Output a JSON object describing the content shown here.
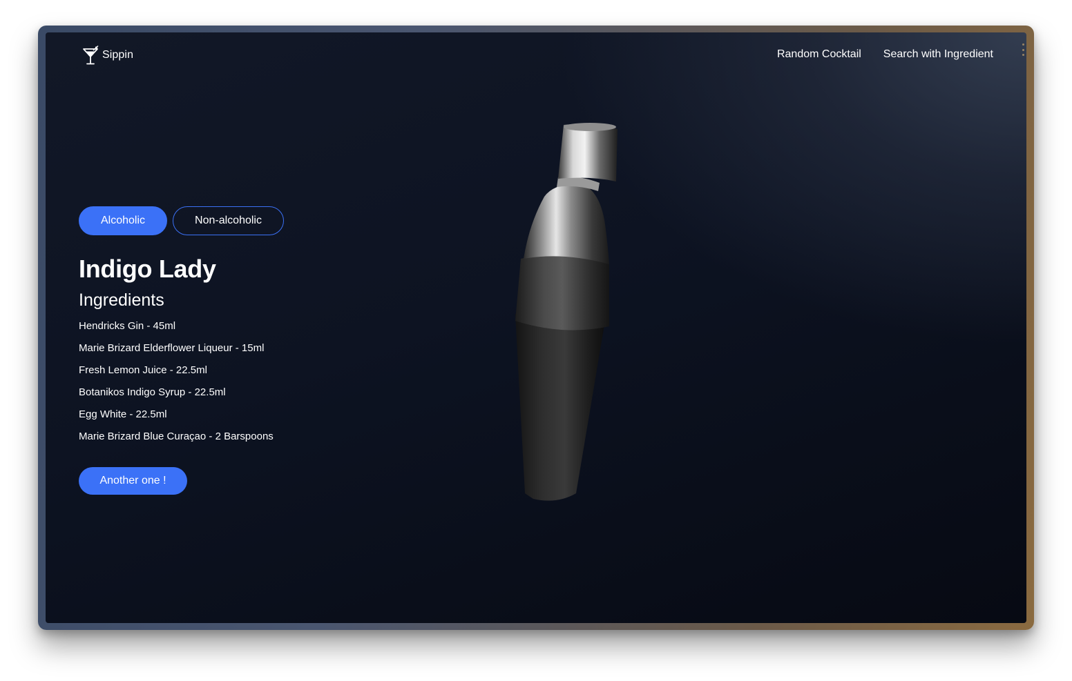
{
  "app": {
    "brand_name": "Sippin",
    "logo_icon": "cocktail-glass-icon"
  },
  "nav": {
    "links": [
      "Random Cocktail",
      "Search with Ingredient"
    ]
  },
  "filters": {
    "options": [
      "Alcoholic",
      "Non-alcoholic"
    ],
    "selected": "Alcoholic"
  },
  "cocktail": {
    "name": "Indigo Lady",
    "ingredients_heading": "Ingredients",
    "ingredients": [
      "Hendricks Gin - 45ml",
      "Marie Brizard Elderflower Liqueur - 15ml",
      "Fresh Lemon Juice - 22.5ml",
      "Botanikos Indigo Syrup - 22.5ml",
      "Egg White - 22.5ml",
      "Marie Brizard Blue Curaçao - 2 Barspoons"
    ]
  },
  "actions": {
    "another_label": "Another one !"
  },
  "colors": {
    "accent": "#3b71f7",
    "background": "#0d1322",
    "text": "#ffffff"
  },
  "scene": {
    "object_icon": "cocktail-shaker-3d-icon"
  }
}
